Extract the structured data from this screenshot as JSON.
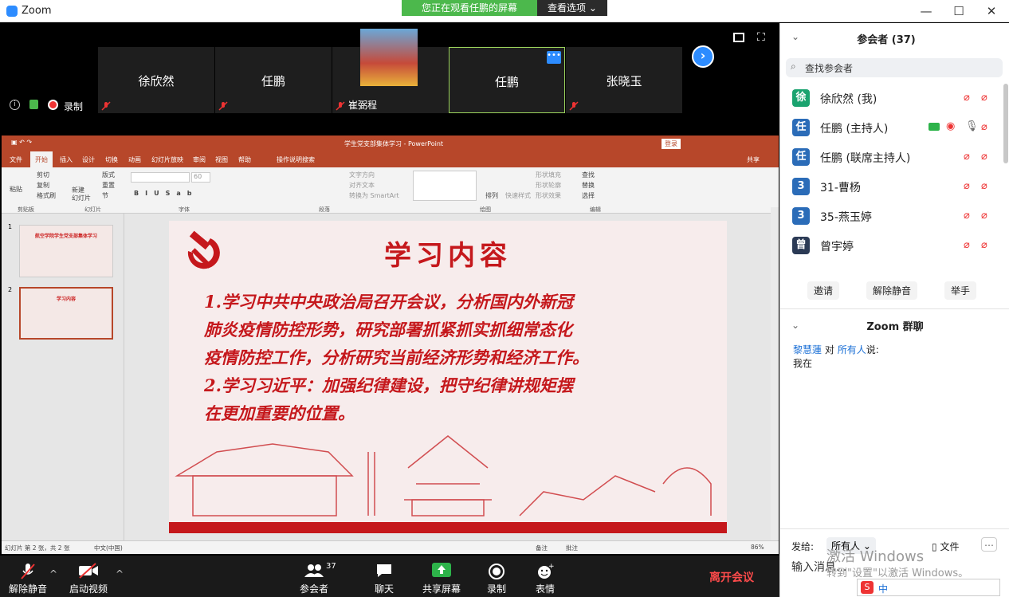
{
  "window": {
    "title": "Zoom",
    "banner": "您正在观看任鹏的屏幕",
    "view_options": "查看选项"
  },
  "video_tiles": [
    {
      "name": "徐欣然",
      "active": false
    },
    {
      "name": "任鹏",
      "active": false
    },
    {
      "name": "崔弼程",
      "active": false
    },
    {
      "name": "任鹏",
      "active": true
    },
    {
      "name": "张晓玉",
      "active": false
    }
  ],
  "record_label": "录制",
  "ppt": {
    "title": "学生党支部集体学习 - PowerPoint",
    "login": "登录",
    "share": "共享",
    "tabs": [
      "文件",
      "开始",
      "插入",
      "设计",
      "切换",
      "动画",
      "幻灯片放映",
      "审阅",
      "视图",
      "帮助",
      "操作说明搜索"
    ],
    "ribbon_groups": [
      "剪贴板",
      "幻灯片",
      "字体",
      "段落",
      "绘图",
      "编辑"
    ],
    "ribbon_items": {
      "paste": "粘贴",
      "cut": "剪切",
      "copy": "复制",
      "format_painter": "格式刷",
      "new_slide": "新建\n幻灯片",
      "layout": "版式",
      "reset": "重置",
      "section": "节",
      "text_dir": "文字方向",
      "align_text": "对齐文本",
      "smartart": "转换为 SmartArt",
      "arrange": "排列",
      "quick_styles": "快速样式",
      "shape_fill": "形状填充",
      "shape_outline": "形状轮廓",
      "shape_effect": "形状效果",
      "find": "查找",
      "replace": "替换",
      "select": "选择",
      "font_size": "60"
    },
    "thumb1_title": "航空学院学生党支部集体学习",
    "thumb2_title": "学习内容",
    "slide_title": "学习内容",
    "slide_lines": [
      "1.学习中共中央政治局召开会议，分析国内外新冠",
      "肺炎疫情防控形势，研究部署抓紧抓实抓细常态化",
      "疫情防控工作，分析研究当前经济形势和经济工作。",
      "2.学习习近平：加强纪律建设，把守纪律讲规矩摆",
      "在更加重要的位置。"
    ],
    "status": {
      "slide": "幻灯片 第 2 张，共 2 张",
      "lang": "中文(中国)",
      "notes": "备注",
      "comments": "批注",
      "zoom": "86%"
    }
  },
  "toolbar": {
    "unmute": "解除静音",
    "start_video": "启动视频",
    "participants": "参会者",
    "participants_count": "37",
    "chat": "聊天",
    "share": "共享屏幕",
    "record": "录制",
    "reactions": "表情",
    "leave": "离开会议"
  },
  "panel": {
    "title": "参会者 (37)",
    "search_placeholder": "查找参会者",
    "participants": [
      {
        "avatar": "徐",
        "name": "徐欣然 (我)",
        "color": "#1aa36f"
      },
      {
        "avatar": "任",
        "name": "任鹏 (主持人)",
        "color": "#2b6cb8"
      },
      {
        "avatar": "任",
        "name": "任鹏 (联席主持人)",
        "color": "#2b6cb8"
      },
      {
        "avatar": "3",
        "name": "31-曹杨",
        "color": "#2b6cb8"
      },
      {
        "avatar": "3",
        "name": "35-燕玉婷",
        "color": "#2b6cb8"
      },
      {
        "avatar": "曾",
        "name": "曾宇婷",
        "color": "#2b3a55"
      }
    ],
    "buttons": {
      "invite": "邀请",
      "unmute_all": "解除静音",
      "raise_hand": "举手"
    },
    "chat_title": "Zoom 群聊",
    "chat_sender": "黎慧蓮",
    "chat_to": "对",
    "chat_target": "所有人",
    "chat_suffix": "说:",
    "chat_msg": "我在",
    "send_to_label": "发给:",
    "send_to_value": "所有人",
    "file": "文件",
    "input_placeholder": "输入消息...",
    "watermark1": "激活 Windows",
    "watermark2": "转到\"设置\"以激活 Windows。",
    "ime": "中"
  }
}
